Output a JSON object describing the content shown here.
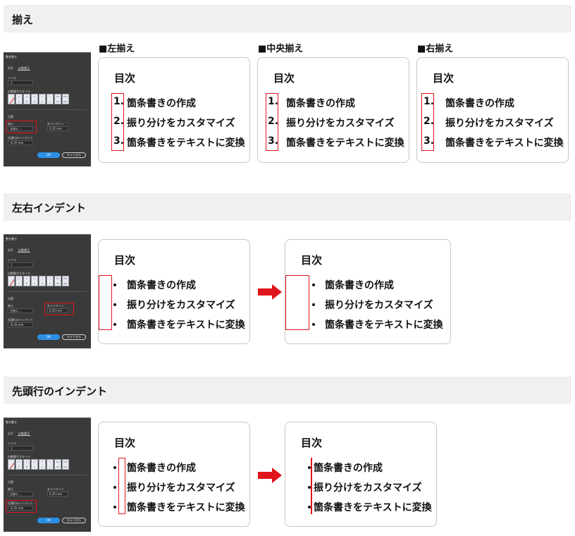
{
  "sections": {
    "align": {
      "title": "揃え"
    },
    "lr_indent": {
      "title": "左右インデント"
    },
    "first_line": {
      "title": "先頭行のインデント"
    }
  },
  "align_labels": [
    "■左揃え",
    "■中央揃え",
    "■右揃え"
  ],
  "card": {
    "title": "目次",
    "markers": [
      "1.",
      "2.",
      "3."
    ],
    "items": [
      "箇条書きの作成",
      "振り分けをカスタマイズ",
      "箇条書きをテキストに変換"
    ]
  },
  "dialog": {
    "title": "整合書き",
    "tab_left": "記号",
    "tab_right": "自動番号",
    "level_label": "レベル",
    "level_value": "1",
    "style_label": "自動番号スタイル",
    "position_label": "位置",
    "align_label": "揃え",
    "align_value": "左揃え",
    "indent_label": "左インデント",
    "indent_value": "6.35 mm",
    "first_line_label": "先頭行のインデント",
    "first_line_value": "-6.35 mm",
    "ok": "OK",
    "cancel": "キャンセル",
    "swatches": [
      "",
      "1\n2",
      "A\nB",
      "a\nb",
      "I\nII",
      "i\nii",
      "01\n02",
      "001\n002"
    ]
  },
  "colors": {
    "highlight": "#e0141b",
    "ok_button": "#2c8fe6",
    "dialog_bg": "#3a3a3a",
    "header_bg": "#f0f0f0"
  }
}
